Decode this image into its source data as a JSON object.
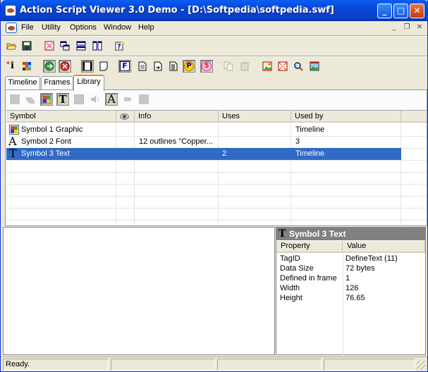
{
  "window": {
    "title": "Action Script Viewer 3.0 Demo - [D:\\Softpedia\\softpedia.swf]",
    "minimize": "_",
    "maximize": "□",
    "close": "✕"
  },
  "menu": {
    "items": [
      "File",
      "Utility",
      "Options",
      "Window",
      "Help"
    ],
    "mdi_minimize": "_",
    "mdi_restore": "❐",
    "mdi_close": "✕"
  },
  "toolbar2": {
    "info_label": "i",
    "font_label": "F",
    "p_label": "P",
    "s_label": "5"
  },
  "tabs": [
    "Timeline",
    "Frames",
    "Library"
  ],
  "filter_toolbar": {
    "text_glyph": "T",
    "font_glyph": "A"
  },
  "library": {
    "columns": [
      "Symbol",
      "",
      "Info",
      "Uses",
      "Used by"
    ],
    "rows": [
      {
        "symbol": "Symbol 1 Graphic",
        "icon": "graphic-icon",
        "info": "",
        "uses": "",
        "used_by": "Timeline",
        "selected": false
      },
      {
        "symbol": "Symbol 2 Font",
        "icon": "font-icon",
        "info": "12 outlines \"Copper...",
        "uses": "",
        "used_by": "3",
        "selected": false
      },
      {
        "symbol": "Symbol 3 Text",
        "icon": "text-icon",
        "info": "",
        "uses": "2",
        "used_by": "Timeline",
        "selected": true
      }
    ]
  },
  "properties": {
    "title": "Symbol 3 Text",
    "columns": [
      "Property",
      "Value"
    ],
    "rows": [
      {
        "property": "TagID",
        "value": "DefineText (11)"
      },
      {
        "property": "Data Size",
        "value": "72 bytes"
      },
      {
        "property": "Defined in frame",
        "value": "1"
      },
      {
        "property": "Width",
        "value": "126"
      },
      {
        "property": "Height",
        "value": "76.65"
      }
    ]
  },
  "status": {
    "text": "Ready."
  },
  "colors": {
    "selection": "#316ac5",
    "titlebar": "#0845d8"
  }
}
